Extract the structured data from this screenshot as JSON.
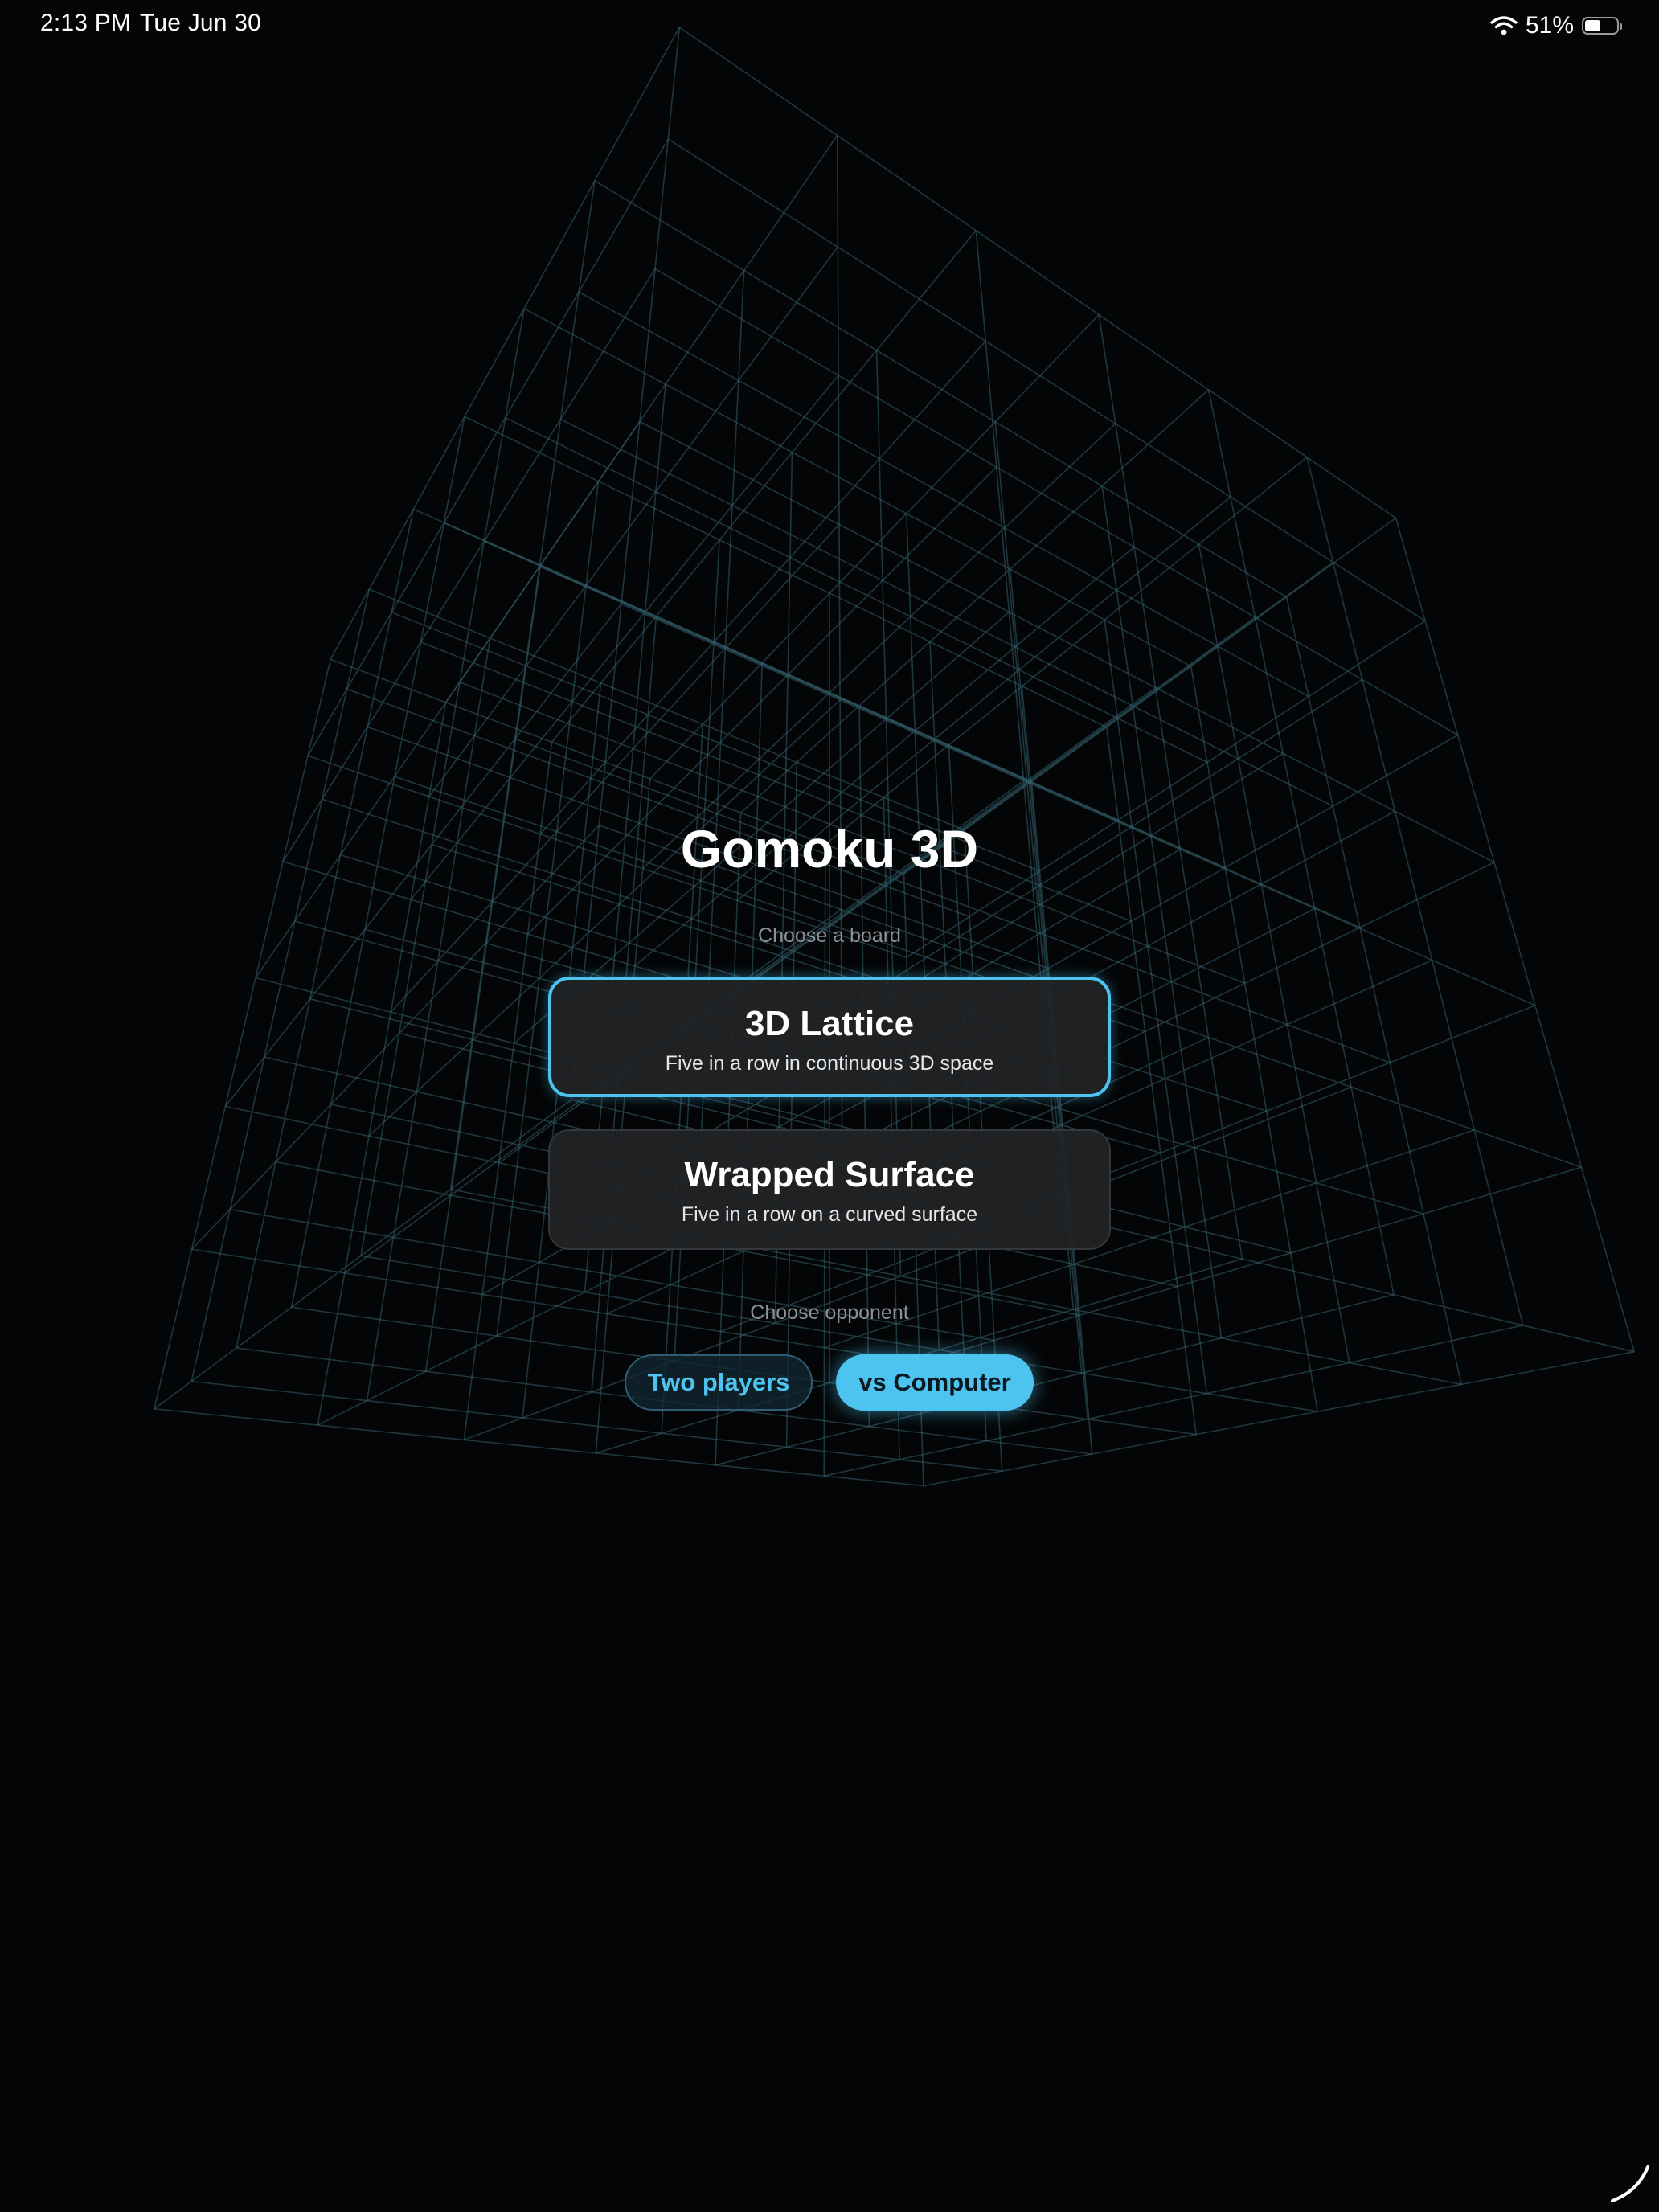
{
  "status_bar": {
    "time": "2:13 PM",
    "date": "Tue Jun 30",
    "battery_percent_text": "51%",
    "battery_level": 0.51,
    "wifi_icon": "wifi-icon",
    "battery_icon": "battery-icon"
  },
  "menu": {
    "title": "Gomoku 3D",
    "board_label": "Choose a board",
    "boards": [
      {
        "title": "3D Lattice",
        "subtitle": "Five in a row in continuous 3D space",
        "selected": true
      },
      {
        "title": "Wrapped Surface",
        "subtitle": "Five in a row on a curved surface",
        "selected": false
      }
    ],
    "opponent_label": "Choose opponent",
    "opponents": [
      {
        "label": "Two players",
        "selected": false
      },
      {
        "label": "vs Computer",
        "selected": true
      }
    ]
  },
  "colors": {
    "background": "#040506",
    "accent": "#4dc3f0",
    "lattice_line": "#35606e",
    "card_bg": "#222426",
    "muted_text": "#8c9196"
  }
}
